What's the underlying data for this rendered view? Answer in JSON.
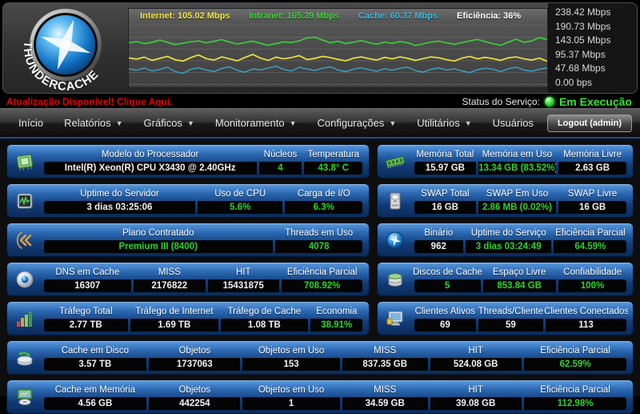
{
  "brand": {
    "name": "THUNDERCACHE"
  },
  "chart_data": {
    "type": "line",
    "title": "",
    "xlabel": "",
    "ylabel": "",
    "ylim": [
      0,
      238.42
    ],
    "grid": true,
    "legend_position": "top",
    "y_ticks": [
      "238.42 Mbps",
      "190.73 Mbps",
      "143.05 Mbps",
      "95.37 Mbps",
      "47.68 Mbps",
      "0.00 bps"
    ],
    "legend": [
      {
        "label": "Internet: 105.02 Mbps",
        "color": "#f2e53e"
      },
      {
        "label": "Intranet: 165.39 Mbps",
        "color": "#3ed43e"
      },
      {
        "label": "Cache: 60.37 Mbps",
        "color": "#41b9de"
      },
      {
        "label": "Eficiência: 36%",
        "color": "#ffffff"
      }
    ],
    "series": [
      {
        "name": "intranet",
        "color": "#3ccc3c",
        "values": [
          168,
          173,
          165,
          170,
          179,
          170,
          161,
          167,
          172,
          176,
          168,
          174,
          181,
          171,
          163,
          169,
          175,
          166,
          158,
          165,
          172,
          169,
          176,
          188,
          191,
          179,
          168,
          174,
          165,
          171,
          177,
          169,
          162,
          171,
          166,
          173,
          168,
          157,
          164,
          171,
          175,
          168,
          162,
          169,
          176,
          182,
          173,
          164,
          158,
          171,
          183,
          170,
          176,
          189,
          181
        ]
      },
      {
        "name": "internet",
        "color": "#ece23c",
        "values": [
          107,
          102,
          110,
          97,
          105,
          113,
          99,
          94,
          108,
          119,
          104,
          98,
          111,
          103,
          95,
          109,
          121,
          106,
          97,
          110,
          103,
          108,
          116,
          100,
          105,
          113,
          108,
          101,
          95,
          106,
          111,
          104,
          98,
          109,
          103,
          111,
          105,
          97,
          104,
          111,
          107,
          100,
          94,
          106,
          113,
          103,
          109,
          104,
          97,
          107,
          111,
          103,
          98,
          106,
          93
        ]
      },
      {
        "name": "cache",
        "color": "#3da4c8",
        "values": [
          63,
          57,
          66,
          54,
          60,
          69,
          51,
          44,
          61,
          67,
          58,
          51,
          64,
          71,
          56,
          49,
          62,
          58,
          66,
          73,
          60,
          54,
          69,
          62,
          56,
          65,
          71,
          58,
          51,
          61,
          67,
          59,
          53,
          63,
          57,
          65,
          69,
          55,
          49,
          61,
          66,
          58,
          63,
          54,
          47,
          59,
          65,
          61,
          51,
          63,
          69,
          58,
          53,
          61,
          66
        ]
      }
    ]
  },
  "alert": {
    "update_text": "Atualização Disponível! Clique Aqui.",
    "status_label": "Status do Serviço:",
    "status_value": "Em Execução"
  },
  "nav": {
    "items": [
      {
        "label": "Início",
        "dropdown": false
      },
      {
        "label": "Relatórios",
        "dropdown": true
      },
      {
        "label": "Gráficos",
        "dropdown": true
      },
      {
        "label": "Monitoramento",
        "dropdown": true
      },
      {
        "label": "Configurações",
        "dropdown": true
      },
      {
        "label": "Utilitários",
        "dropdown": true
      },
      {
        "label": "Usuários",
        "dropdown": false
      }
    ],
    "logout_label": "Logout (admin)"
  },
  "colors": {
    "panel_blue_top": "#5b9ade",
    "panel_blue_bottom": "#0a2b5a",
    "value_green": "#2ad42a",
    "alert_red": "#e60000",
    "status_green": "#2fe82f"
  },
  "panels": {
    "r1l": {
      "icon": "cpu",
      "cols": [
        {
          "h": "Modelo do Processador",
          "v": "Intel(R) Xeon(R) CPU X3430 @ 2.40GHz",
          "green": false
        },
        {
          "h": "Núcleos",
          "v": "4",
          "green": true
        },
        {
          "h": "Temperatura",
          "v": "43.8° C",
          "green": true
        }
      ]
    },
    "r1r": {
      "icon": "memory",
      "cols": [
        {
          "h": "Memória Total",
          "v": "15.97 GB",
          "green": false
        },
        {
          "h": "Memória em Uso",
          "v": "13.34 GB (83.52%)",
          "green": true
        },
        {
          "h": "Memória Livre",
          "v": "2.63 GB",
          "green": false
        }
      ]
    },
    "r2l": {
      "icon": "activity",
      "cols": [
        {
          "h": "Uptime do Servidor",
          "v": "3 dias 03:25:06",
          "green": false
        },
        {
          "h": "Uso de CPU",
          "v": "5.6%",
          "green": true
        },
        {
          "h": "Carga de I/O",
          "v": "6.3%",
          "green": true
        }
      ]
    },
    "r2r": {
      "icon": "swap",
      "cols": [
        {
          "h": "SWAP Total",
          "v": "16 GB",
          "green": false
        },
        {
          "h": "SWAP Em Uso",
          "v": "2.86 MB (0.02%)",
          "green": true
        },
        {
          "h": "SWAP Livre",
          "v": "16 GB",
          "green": false
        }
      ]
    },
    "r3l": {
      "icon": "plan",
      "cols": [
        {
          "h": "Plano Contratado",
          "v": "Premium III (8400)",
          "green": true
        },
        {
          "h": "Threads em Uso",
          "v": "4078",
          "green": true
        }
      ]
    },
    "r3r": {
      "icon": "globe",
      "cols": [
        {
          "h": "Binário",
          "v": "962",
          "green": false
        },
        {
          "h": "Uptime do Serviço",
          "v": "3 dias 03:24:49",
          "green": true
        },
        {
          "h": "Eficiência Parcial",
          "v": "64.59%",
          "green": true
        }
      ]
    },
    "r4l": {
      "icon": "dns",
      "cols": [
        {
          "h": "DNS em Cache",
          "v": "16307",
          "green": false
        },
        {
          "h": "MISS",
          "v": "2176822",
          "green": false
        },
        {
          "h": "HIT",
          "v": "15431875",
          "green": false
        },
        {
          "h": "Eficiência Parcial",
          "v": "708.92%",
          "green": true
        }
      ]
    },
    "r4r": {
      "icon": "disks",
      "cols": [
        {
          "h": "Discos de Cache",
          "v": "5",
          "green": true
        },
        {
          "h": "Espaço Livre",
          "v": "853.84 GB",
          "green": true
        },
        {
          "h": "Confiabilidade",
          "v": "100%",
          "green": true
        }
      ]
    },
    "r5l": {
      "icon": "traffic",
      "cols": [
        {
          "h": "Tráfego Total",
          "v": "2.77 TB",
          "green": false
        },
        {
          "h": "Tráfego de Internet",
          "v": "1.69 TB",
          "green": false
        },
        {
          "h": "Tráfego de Cache",
          "v": "1.08 TB",
          "green": false
        },
        {
          "h": "Economia",
          "v": "38.91%",
          "green": true
        }
      ]
    },
    "r5r": {
      "icon": "clients",
      "cols": [
        {
          "h": "Clientes Ativos",
          "v": "69",
          "green": false
        },
        {
          "h": "Threads/Cliente",
          "v": "59",
          "green": false
        },
        {
          "h": "Clientes Conectados",
          "v": "113",
          "green": false
        }
      ]
    },
    "r6": {
      "icon": "diskcache",
      "cols": [
        {
          "h": "Cache em Disco",
          "v": "3.57 TB",
          "green": false
        },
        {
          "h": "Objetos",
          "v": "1737063",
          "green": false
        },
        {
          "h": "Objetos em Uso",
          "v": "153",
          "green": false
        },
        {
          "h": "MISS",
          "v": "837.35 GB",
          "green": false
        },
        {
          "h": "HIT",
          "v": "524.08 GB",
          "green": false
        },
        {
          "h": "Eficiência Parcial",
          "v": "62.59%",
          "green": true
        }
      ]
    },
    "r7": {
      "icon": "memcache",
      "cols": [
        {
          "h": "Cache em Memória",
          "v": "4.56 GB",
          "green": false
        },
        {
          "h": "Objetos",
          "v": "442254",
          "green": false
        },
        {
          "h": "Objetos em Uso",
          "v": "1",
          "green": false
        },
        {
          "h": "MISS",
          "v": "34.59 GB",
          "green": false
        },
        {
          "h": "HIT",
          "v": "39.08 GB",
          "green": false
        },
        {
          "h": "Eficiência Parcial",
          "v": "112.98%",
          "green": true
        }
      ]
    }
  }
}
